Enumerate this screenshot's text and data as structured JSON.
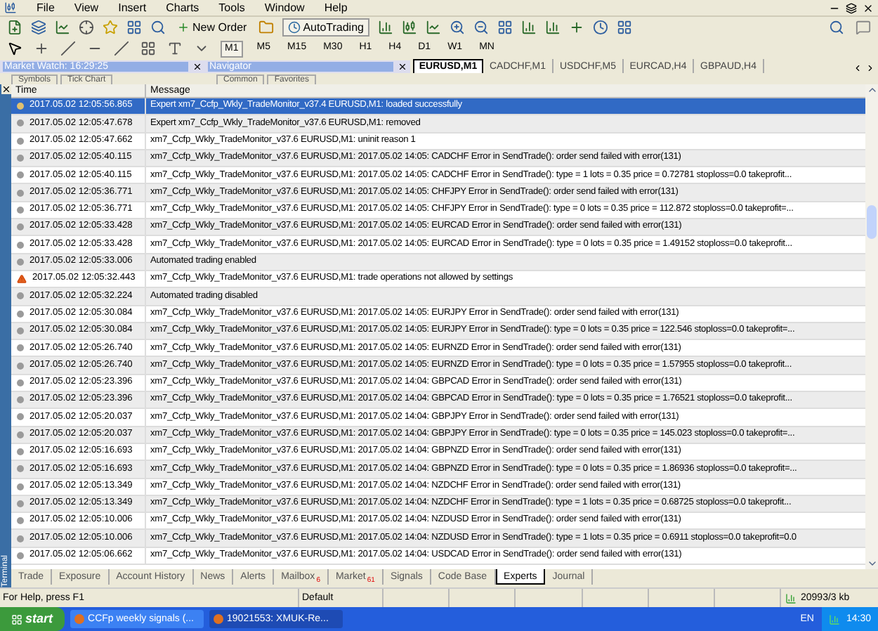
{
  "menu": [
    "File",
    "View",
    "Insert",
    "Charts",
    "Tools",
    "Window",
    "Help"
  ],
  "toolbar": {
    "new_order": "New Order",
    "autotrading": "AutoTrading"
  },
  "timeframes": [
    {
      "label": "M1",
      "selected": true
    },
    {
      "label": "M5",
      "selected": false
    },
    {
      "label": "M15",
      "selected": false
    },
    {
      "label": "M30",
      "selected": false
    },
    {
      "label": "H1",
      "selected": false
    },
    {
      "label": "H4",
      "selected": false
    },
    {
      "label": "D1",
      "selected": false
    },
    {
      "label": "W1",
      "selected": false
    },
    {
      "label": "MN",
      "selected": false
    }
  ],
  "panels": [
    {
      "title": "Market Watch: 16:29:25",
      "tabs": [
        "Symbols",
        "Tick Chart"
      ]
    },
    {
      "title": "Navigator",
      "tabs": [
        "Common",
        "Favorites"
      ]
    }
  ],
  "chart_tabs": [
    {
      "label": "EURUSD,M1",
      "selected": true
    },
    {
      "label": "CADCHF,M1",
      "selected": false
    },
    {
      "label": "USDCHF,M5",
      "selected": false
    },
    {
      "label": "EURCAD,H4",
      "selected": false
    },
    {
      "label": "GBPAUD,H4",
      "selected": false
    }
  ],
  "terminal": {
    "side_label": "Terminal",
    "columns": [
      "Time",
      "Message"
    ],
    "rows": [
      {
        "kind": "info",
        "selected": true,
        "time": "2017.05.02 12:05:56.865",
        "message": "Expert xm7_Ccfp_Wkly_TradeMonitor_v37.4 EURUSD,M1: loaded successfully"
      },
      {
        "kind": "info",
        "selected": false,
        "time": "2017.05.02 12:05:47.678",
        "message": "Expert xm7_Ccfp_Wkly_TradeMonitor_v37.6 EURUSD,M1: removed"
      },
      {
        "kind": "info",
        "selected": false,
        "time": "2017.05.02 12:05:47.662",
        "message": "xm7_Ccfp_Wkly_TradeMonitor_v37.6 EURUSD,M1: uninit reason 1"
      },
      {
        "kind": "info",
        "selected": false,
        "time": "2017.05.02 12:05:40.115",
        "message": "xm7_Ccfp_Wkly_TradeMonitor_v37.6 EURUSD,M1: 2017.05.02 14:05: CADCHF Error in SendTrade(): order send failed with error(131)"
      },
      {
        "kind": "info",
        "selected": false,
        "time": "2017.05.02 12:05:40.115",
        "message": "xm7_Ccfp_Wkly_TradeMonitor_v37.6 EURUSD,M1: 2017.05.02 14:05: CADCHF Error in SendTrade(): type = 1  lots = 0.35  price = 0.72781   stoploss=0.0  takeprofit..."
      },
      {
        "kind": "info",
        "selected": false,
        "time": "2017.05.02 12:05:36.771",
        "message": "xm7_Ccfp_Wkly_TradeMonitor_v37.6 EURUSD,M1: 2017.05.02 14:05: CHFJPY Error in SendTrade(): order send failed with error(131)"
      },
      {
        "kind": "info",
        "selected": false,
        "time": "2017.05.02 12:05:36.771",
        "message": "xm7_Ccfp_Wkly_TradeMonitor_v37.6 EURUSD,M1: 2017.05.02 14:05: CHFJPY Error in SendTrade(): type = 0  lots = 0.35  price = 112.872   stoploss=0.0  takeprofit=..."
      },
      {
        "kind": "info",
        "selected": false,
        "time": "2017.05.02 12:05:33.428",
        "message": "xm7_Ccfp_Wkly_TradeMonitor_v37.6 EURUSD,M1: 2017.05.02 14:05: EURCAD Error in SendTrade(): order send failed with error(131)"
      },
      {
        "kind": "info",
        "selected": false,
        "time": "2017.05.02 12:05:33.428",
        "message": "xm7_Ccfp_Wkly_TradeMonitor_v37.6 EURUSD,M1: 2017.05.02 14:05: EURCAD Error in SendTrade(): type = 0  lots = 0.35  price = 1.49152   stoploss=0.0  takeprofit..."
      },
      {
        "kind": "info",
        "selected": false,
        "time": "2017.05.02 12:05:33.006",
        "message": "Automated trading enabled"
      },
      {
        "kind": "warning",
        "selected": false,
        "time": "2017.05.02 12:05:32.443",
        "message": "xm7_Ccfp_Wkly_TradeMonitor_v37.6 EURUSD,M1: trade operations not allowed by settings"
      },
      {
        "kind": "info",
        "selected": false,
        "time": "2017.05.02 12:05:32.224",
        "message": "Automated trading disabled"
      },
      {
        "kind": "info",
        "selected": false,
        "time": "2017.05.02 12:05:30.084",
        "message": "xm7_Ccfp_Wkly_TradeMonitor_v37.6 EURUSD,M1: 2017.05.02 14:05: EURJPY Error in SendTrade(): order send failed with error(131)"
      },
      {
        "kind": "info",
        "selected": false,
        "time": "2017.05.02 12:05:30.084",
        "message": "xm7_Ccfp_Wkly_TradeMonitor_v37.6 EURUSD,M1: 2017.05.02 14:05: EURJPY Error in SendTrade(): type = 0  lots = 0.35  price = 122.546   stoploss=0.0  takeprofit=..."
      },
      {
        "kind": "info",
        "selected": false,
        "time": "2017.05.02 12:05:26.740",
        "message": "xm7_Ccfp_Wkly_TradeMonitor_v37.6 EURUSD,M1: 2017.05.02 14:05: EURNZD Error in SendTrade(): order send failed with error(131)"
      },
      {
        "kind": "info",
        "selected": false,
        "time": "2017.05.02 12:05:26.740",
        "message": "xm7_Ccfp_Wkly_TradeMonitor_v37.6 EURUSD,M1: 2017.05.02 14:05: EURNZD Error in SendTrade(): type = 0  lots = 0.35  price = 1.57955   stoploss=0.0  takeprofit..."
      },
      {
        "kind": "info",
        "selected": false,
        "time": "2017.05.02 12:05:23.396",
        "message": "xm7_Ccfp_Wkly_TradeMonitor_v37.6 EURUSD,M1: 2017.05.02 14:04: GBPCAD Error in SendTrade(): order send failed with error(131)"
      },
      {
        "kind": "info",
        "selected": false,
        "time": "2017.05.02 12:05:23.396",
        "message": "xm7_Ccfp_Wkly_TradeMonitor_v37.6 EURUSD,M1: 2017.05.02 14:04: GBPCAD Error in SendTrade(): type = 0  lots = 0.35  price = 1.76521   stoploss=0.0  takeprofit..."
      },
      {
        "kind": "info",
        "selected": false,
        "time": "2017.05.02 12:05:20.037",
        "message": "xm7_Ccfp_Wkly_TradeMonitor_v37.6 EURUSD,M1: 2017.05.02 14:04: GBPJPY Error in SendTrade(): order send failed with error(131)"
      },
      {
        "kind": "info",
        "selected": false,
        "time": "2017.05.02 12:05:20.037",
        "message": "xm7_Ccfp_Wkly_TradeMonitor_v37.6 EURUSD,M1: 2017.05.02 14:04: GBPJPY Error in SendTrade(): type = 0  lots = 0.35  price = 145.023   stoploss=0.0  takeprofit=..."
      },
      {
        "kind": "info",
        "selected": false,
        "time": "2017.05.02 12:05:16.693",
        "message": "xm7_Ccfp_Wkly_TradeMonitor_v37.6 EURUSD,M1: 2017.05.02 14:04: GBPNZD Error in SendTrade(): order send failed with error(131)"
      },
      {
        "kind": "info",
        "selected": false,
        "time": "2017.05.02 12:05:16.693",
        "message": "xm7_Ccfp_Wkly_TradeMonitor_v37.6 EURUSD,M1: 2017.05.02 14:04: GBPNZD Error in SendTrade(): type = 0  lots = 0.35  price = 1.86936   stoploss=0.0  takeprofit=..."
      },
      {
        "kind": "info",
        "selected": false,
        "time": "2017.05.02 12:05:13.349",
        "message": "xm7_Ccfp_Wkly_TradeMonitor_v37.6 EURUSD,M1: 2017.05.02 14:04: NZDCHF Error in SendTrade(): order send failed with error(131)"
      },
      {
        "kind": "info",
        "selected": false,
        "time": "2017.05.02 12:05:13.349",
        "message": "xm7_Ccfp_Wkly_TradeMonitor_v37.6 EURUSD,M1: 2017.05.02 14:04: NZDCHF Error in SendTrade(): type = 1  lots = 0.35  price = 0.68725   stoploss=0.0  takeprofit..."
      },
      {
        "kind": "info",
        "selected": false,
        "time": "2017.05.02 12:05:10.006",
        "message": "xm7_Ccfp_Wkly_TradeMonitor_v37.6 EURUSD,M1: 2017.05.02 14:04: NZDUSD Error in SendTrade(): order send failed with error(131)"
      },
      {
        "kind": "info",
        "selected": false,
        "time": "2017.05.02 12:05:10.006",
        "message": "xm7_Ccfp_Wkly_TradeMonitor_v37.6 EURUSD,M1: 2017.05.02 14:04: NZDUSD Error in SendTrade(): type = 1  lots = 0.35  price = 0.6911   stoploss=0.0  takeprofit=0.0"
      },
      {
        "kind": "info",
        "selected": false,
        "time": "2017.05.02 12:05:06.662",
        "message": "xm7_Ccfp_Wkly_TradeMonitor_v37.6 EURUSD,M1: 2017.05.02 14:04: USDCAD Error in SendTrade(): order send failed with error(131)"
      }
    ],
    "tabs": [
      {
        "label": "Trade",
        "selected": false
      },
      {
        "label": "Exposure",
        "selected": false
      },
      {
        "label": "Account History",
        "selected": false
      },
      {
        "label": "News",
        "selected": false
      },
      {
        "label": "Alerts",
        "selected": false
      },
      {
        "label": "Mailbox",
        "badge": "6",
        "selected": false
      },
      {
        "label": "Market",
        "badge": "61",
        "selected": false
      },
      {
        "label": "Signals",
        "selected": false
      },
      {
        "label": "Code Base",
        "selected": false
      },
      {
        "label": "Experts",
        "selected": true
      },
      {
        "label": "Journal",
        "selected": false
      }
    ]
  },
  "status_bar": {
    "help": "For Help, press F1",
    "profile": "Default",
    "traffic": "20993/3 kb"
  },
  "taskbar": {
    "start": "start",
    "windows": [
      "CCFp weekly signals (...",
      "19021553: XMUK-Re..."
    ],
    "language": "EN",
    "clock": "14:30"
  }
}
